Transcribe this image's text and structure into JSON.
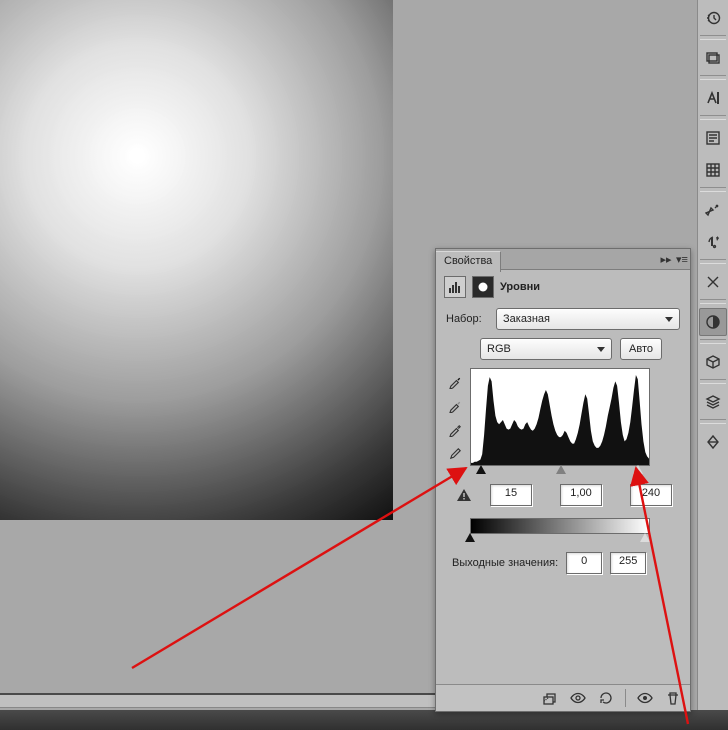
{
  "panel": {
    "tab_label": "Свойства",
    "title": "Уровни",
    "preset_label": "Набор:",
    "preset_value": "Заказная",
    "channel_value": "RGB",
    "auto_label": "Авто",
    "input_black": "15",
    "input_gamma": "1,00",
    "input_white": "240",
    "output_label": "Выходные значения:",
    "output_black": "0",
    "output_white": "255"
  },
  "sidebar_icons": [
    "history-icon",
    "layers-stack-icon",
    "character-icon",
    "paragraph-styles-icon",
    "glyphs-icon",
    "tools-icon",
    "arrow-right-icon",
    "adjustments-icon",
    "cube-icon",
    "layers-icon",
    "diamond-icon"
  ],
  "chart_data": {
    "type": "histogram",
    "xrange": [
      0,
      255
    ],
    "sliders": {
      "black": 15,
      "gamma": 1.0,
      "white": 240
    },
    "output": {
      "black": 0,
      "white": 255
    },
    "values": [
      2,
      2,
      3,
      3,
      4,
      5,
      10,
      28,
      52,
      74,
      82,
      78,
      60,
      46,
      40,
      38,
      40,
      42,
      38,
      34,
      33,
      34,
      38,
      42,
      40,
      36,
      34,
      33,
      34,
      38,
      40,
      36,
      33,
      32,
      34,
      38,
      44,
      52,
      60,
      66,
      70,
      66,
      56,
      46,
      38,
      32,
      28,
      26,
      26,
      28,
      32,
      30,
      26,
      22,
      20,
      20,
      24,
      30,
      38,
      48,
      58,
      66,
      62,
      48,
      32,
      22,
      18,
      16,
      16,
      18,
      22,
      28,
      36,
      46,
      54,
      62,
      72,
      78,
      74,
      58,
      40,
      28,
      22,
      24,
      30,
      40,
      54,
      70,
      84,
      80,
      60,
      38,
      22,
      12,
      8,
      6
    ]
  }
}
